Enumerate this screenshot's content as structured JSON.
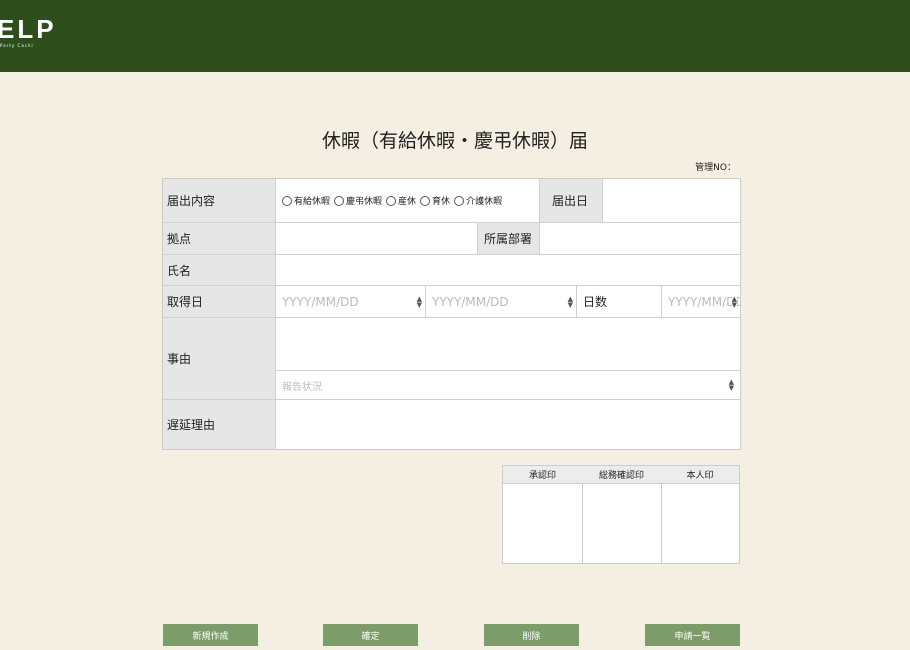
{
  "header": {
    "logo": "ELP",
    "logo_sub": "Party Cachi"
  },
  "page": {
    "title": "休暇（有給休暇・慶弔休暇）届",
    "mgmt_no_label": "管理NO："
  },
  "form": {
    "notice_content_label": "届出内容",
    "leave_types": [
      "有給休暇",
      "慶弔休暇",
      "産休",
      "育休",
      "介護休暇"
    ],
    "notice_date_label": "届出日",
    "base_label": "拠点",
    "dept_label": "所属部署",
    "name_label": "氏名",
    "acq_date_label": "取得日",
    "date_placeholder": "YYYY/MM/DD",
    "days_label": "日数",
    "days_placeholder": "YYYY/MM/DD",
    "reason_label": "事由",
    "report_status_placeholder": "報告状況",
    "delay_reason_label": "遅延理由"
  },
  "stamps": [
    "承認印",
    "総務確認印",
    "本人印"
  ],
  "buttons": {
    "new": "新規作成",
    "confirm": "確定",
    "delete": "削除",
    "list": "申請一覧"
  }
}
